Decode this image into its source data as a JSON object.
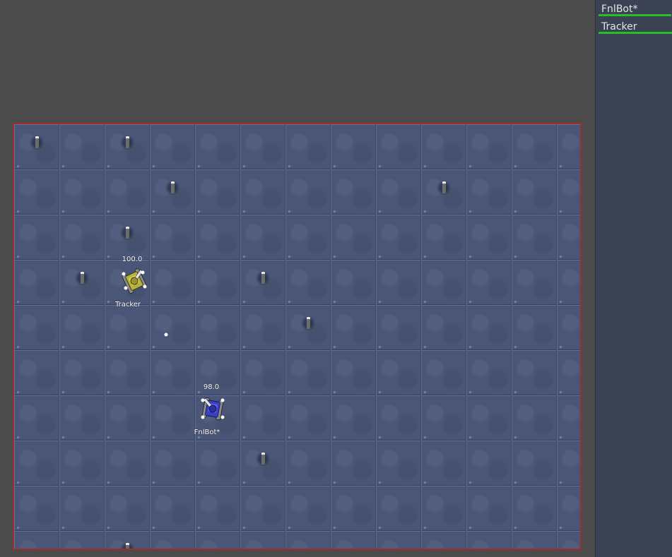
{
  "battlefield": {
    "border_color": "#a02c2c",
    "mines": [
      {
        "col": 0,
        "row": 0
      },
      {
        "col": 2,
        "row": 0
      },
      {
        "col": 3,
        "row": 1
      },
      {
        "col": 9,
        "row": 1
      },
      {
        "col": 2,
        "row": 2
      },
      {
        "col": 1,
        "row": 3
      },
      {
        "col": 5,
        "row": 3
      },
      {
        "col": 6,
        "row": 4
      },
      {
        "col": 5,
        "row": 7
      },
      {
        "col": 2,
        "row": 9
      }
    ],
    "robots": [
      {
        "name": "Tracker",
        "energy": "100.0",
        "color": "#c9c54a"
      },
      {
        "name": "FnlBot*",
        "energy": "98.0",
        "color": "#3a3fc7"
      }
    ]
  },
  "sidebar": {
    "robots": [
      {
        "name": "FnlBot*",
        "energy_fraction": 0.98,
        "bar_color": "#23c123"
      },
      {
        "name": "Tracker",
        "energy_fraction": 1.0,
        "bar_color": "#23c123"
      }
    ]
  }
}
